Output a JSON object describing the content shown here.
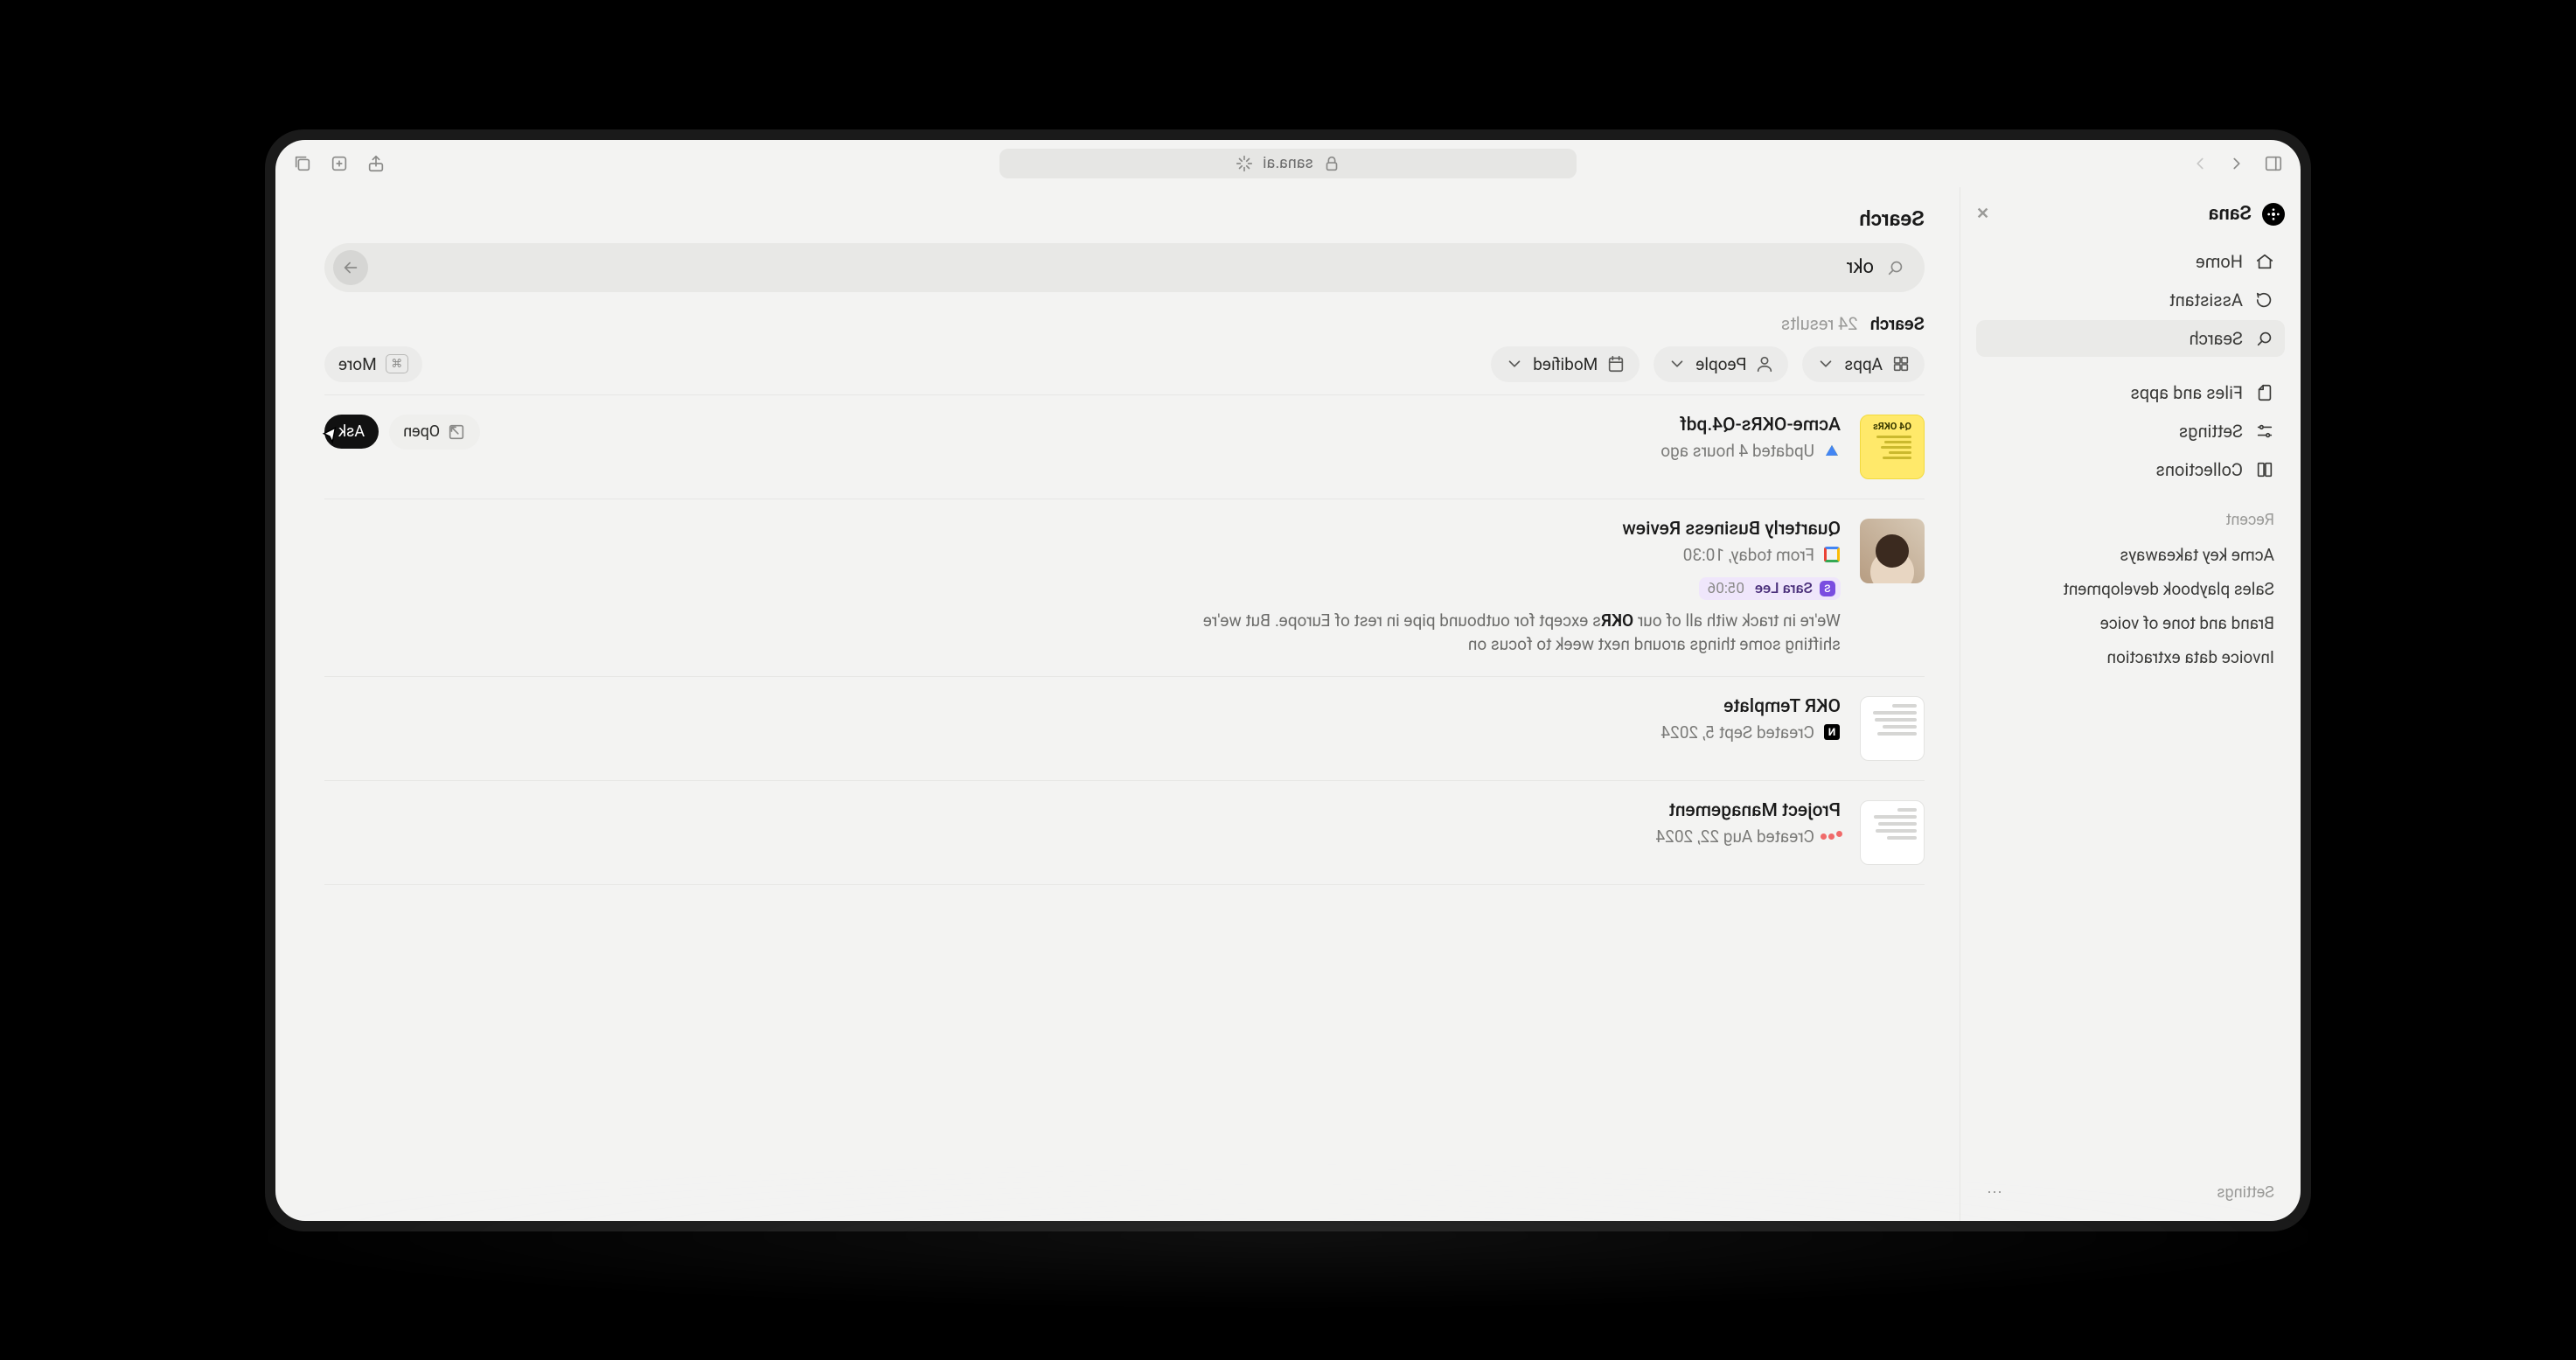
{
  "browser": {
    "url": "sana.ai"
  },
  "brand": "Sana",
  "nav": {
    "home": "Home",
    "assistant": "Assistant",
    "search": "Search",
    "files": "Files and apps",
    "settings": "Settings",
    "collections": "Collections"
  },
  "recent": {
    "heading": "Recent",
    "items": [
      "Acme key takeaways",
      "Sales playbook development",
      "Brand and tone of voice",
      "Invoice data extraction"
    ]
  },
  "sidebar_footer": "Settings",
  "page": {
    "title": "Search",
    "query": "okr",
    "results_label": "Search",
    "results_count": "24 results"
  },
  "filters": {
    "apps": "Apps",
    "people": "People",
    "modified": "Modified",
    "more": "More"
  },
  "actions": {
    "open": "Open",
    "ask": "Ask"
  },
  "results": [
    {
      "title": "Acme-OKRs-Q4.pdf",
      "meta": "Updated 4 hours ago",
      "source": "gdrive",
      "thumb_label": "Q4 OKRs"
    },
    {
      "title": "Quarterly Business Review",
      "meta": "From today, 10:30",
      "source": "gcal",
      "person": "Sara Lee",
      "person_time": "05:06",
      "snippet_pre": "We're in track with all of our ",
      "snippet_bold": "OKR",
      "snippet_post": "s except for outbound pipe in rest of Europe. But we're shifting some things around next week to focus on"
    },
    {
      "title": "OKR Template",
      "meta": "Created Sept 5, 2024",
      "source": "notion"
    },
    {
      "title": "Project Management",
      "meta": "Created Aug 22, 2024",
      "source": "asana"
    }
  ]
}
